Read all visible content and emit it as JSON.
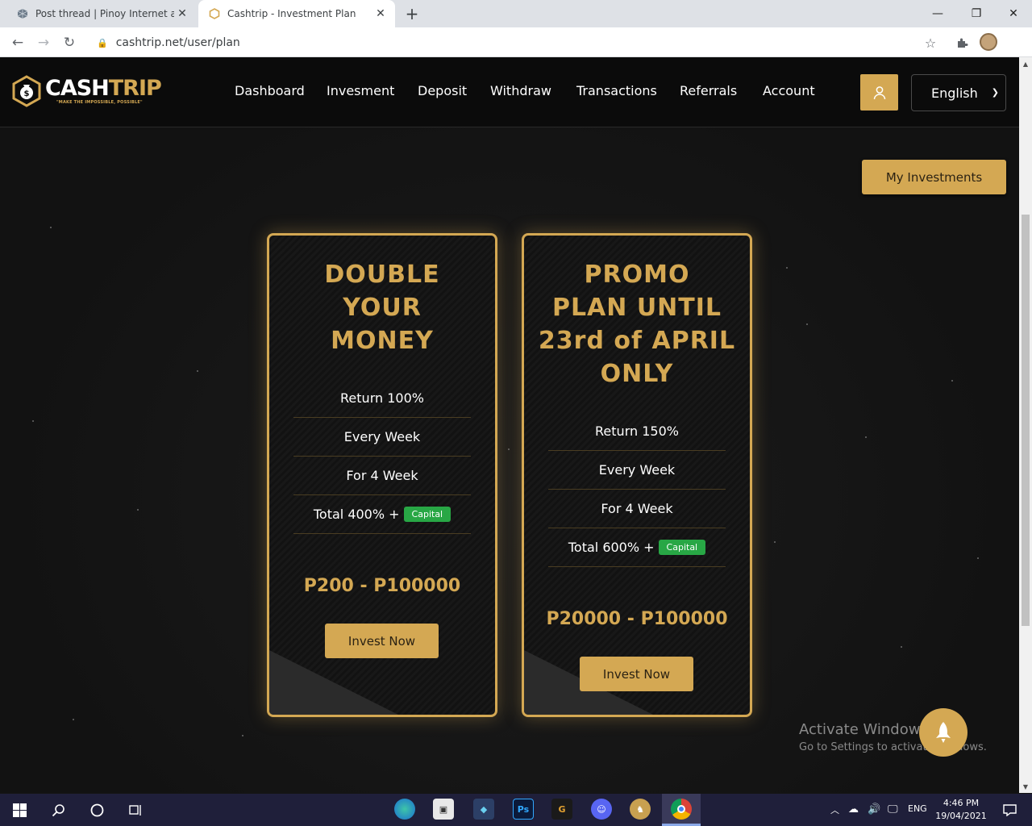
{
  "browser": {
    "tabs": [
      {
        "title": "Post thread | Pinoy Internet and T",
        "active": false
      },
      {
        "title": "Cashtrip - Investment Plan",
        "active": true
      }
    ],
    "url": "cashtrip.net/user/plan"
  },
  "site": {
    "logo_text_white": "CASH",
    "logo_text_gold": "TRIP",
    "logo_tagline": "\"MAKE THE IMPOSSIBLE, POSSIBLE\"",
    "nav": [
      "Dashboard",
      "Invesment",
      "Deposit",
      "Withdraw",
      "Transactions",
      "Referrals",
      "Account"
    ],
    "language": "English",
    "my_investments": "My Investments"
  },
  "plans": [
    {
      "title_lines": [
        "DOUBLE",
        "YOUR",
        "MONEY"
      ],
      "features": [
        "Return 100%",
        "Every Week",
        "For 4 Week"
      ],
      "total": "Total 400% +",
      "badge": "Capital",
      "price": "P200 - P100000",
      "button": "Invest Now"
    },
    {
      "title_lines": [
        "PROMO",
        "PLAN UNTIL",
        "23rd of APRIL",
        "ONLY"
      ],
      "features": [
        "Return 150%",
        "Every Week",
        "For 4 Week"
      ],
      "total": "Total 600% +",
      "badge": "Capital",
      "price": "P20000 - P100000",
      "button": "Invest Now"
    }
  ],
  "watermark": {
    "line1": "Activate Windows",
    "line2": "Go to Settings to activate Windows."
  },
  "taskbar": {
    "language": "ENG",
    "time": "4:46 PM",
    "date": "19/04/2021"
  },
  "colors": {
    "gold": "#d4a853",
    "badge_green": "#28a745"
  }
}
